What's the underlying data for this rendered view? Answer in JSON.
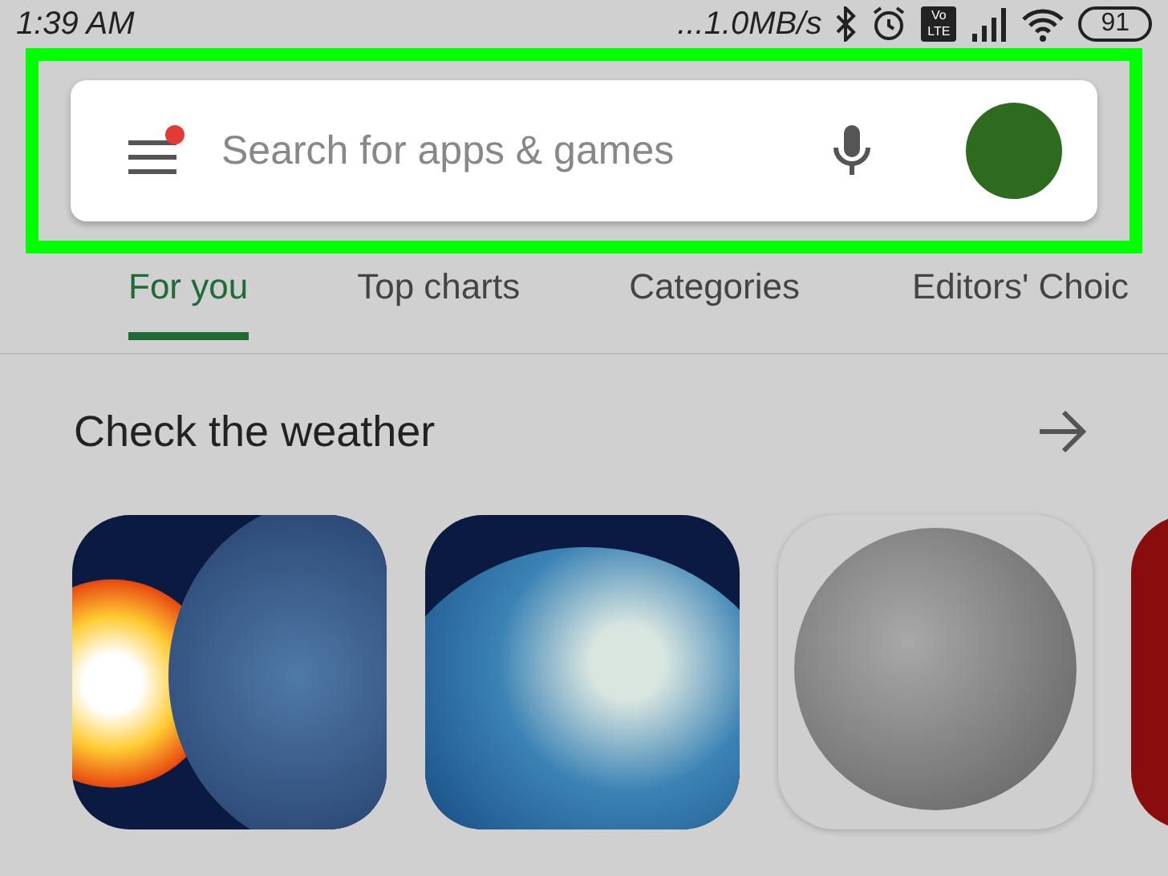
{
  "status_bar": {
    "time": "1:39 AM",
    "network_speed": "...1.0MB/s",
    "volte": "Vo LTE",
    "battery": "91"
  },
  "search_bar": {
    "placeholder": "Search for apps & games",
    "menu_notification": true,
    "highlighted": true
  },
  "tabs": [
    {
      "label": "For you",
      "selected": true
    },
    {
      "label": "Top charts",
      "selected": false
    },
    {
      "label": "Categories",
      "selected": false
    },
    {
      "label": "Editors' Choic",
      "selected": false
    }
  ],
  "section": {
    "title": "Check the weather"
  },
  "apps": [
    {
      "kind": "sun-earth"
    },
    {
      "kind": "storm-earth"
    },
    {
      "kind": "moon"
    },
    {
      "kind": "red"
    }
  ]
}
